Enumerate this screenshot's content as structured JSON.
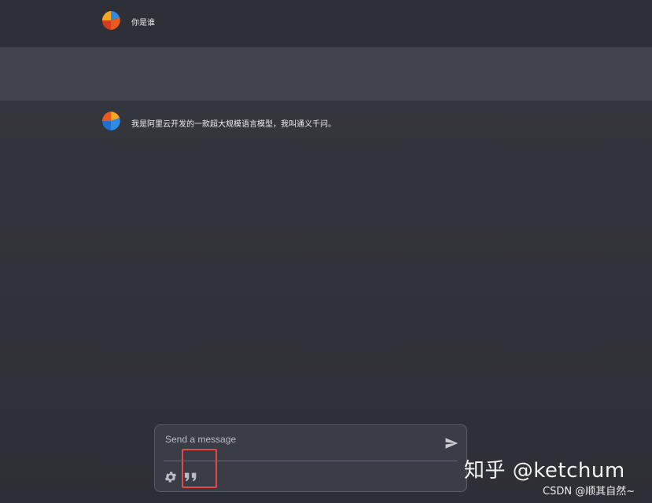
{
  "conversation": [
    {
      "role": "user",
      "text": "你是谁"
    },
    {
      "role": "assistant",
      "text": "我是阿里云开发的一款超大规模语言模型，我叫通义千问。"
    }
  ],
  "composer": {
    "placeholder": "Send a message",
    "value": ""
  },
  "icons": {
    "avatar": "app-logo-icon",
    "send": "send-icon",
    "settings": "gear-icon",
    "quote": "quote-icon"
  },
  "watermark": {
    "main": "知乎 @ketchum",
    "sub": "CSDN @顺其自然~"
  },
  "colors": {
    "highlight": "#e34949",
    "background": "#2f3139",
    "assistant_row": "#41444c"
  }
}
